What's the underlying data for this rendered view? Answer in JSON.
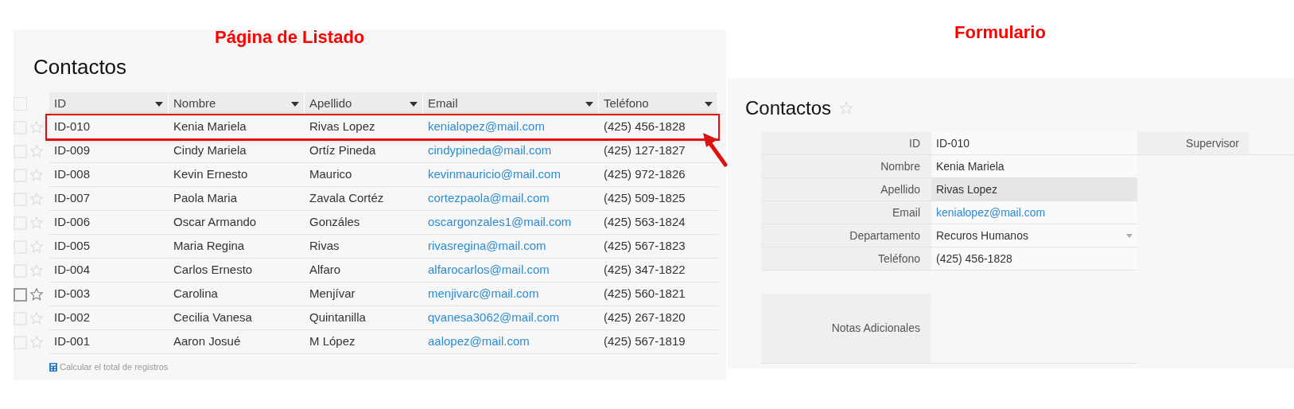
{
  "annotations": {
    "list_label": "Página de Listado",
    "form_label": "Formulario"
  },
  "list": {
    "title": "Contactos",
    "columns": [
      "ID",
      "Nombre",
      "Apellido",
      "Email",
      "Teléfono"
    ],
    "select_all_checked": false,
    "rows": [
      {
        "id": "ID-010",
        "nombre": "Kenia Mariela",
        "apellido": "Rivas Lopez",
        "email": "kenialopez@mail.com",
        "telefono": "(425) 456-1828",
        "highlighted": true,
        "hovered": false,
        "checked": false
      },
      {
        "id": "ID-009",
        "nombre": "Cindy Mariela",
        "apellido": "Ortíz Pineda",
        "email": "cindypineda@mail.com",
        "telefono": "(425) 127-1827",
        "highlighted": false,
        "hovered": false,
        "checked": false
      },
      {
        "id": "ID-008",
        "nombre": "Kevin Ernesto",
        "apellido": "Maurico",
        "email": "kevinmauricio@mail.com",
        "telefono": "(425) 972-1826",
        "highlighted": false,
        "hovered": false,
        "checked": false
      },
      {
        "id": "ID-007",
        "nombre": "Paola Maria",
        "apellido": "Zavala Cortéz",
        "email": "cortezpaola@mail.com",
        "telefono": "(425) 509-1825",
        "highlighted": false,
        "hovered": false,
        "checked": false
      },
      {
        "id": "ID-006",
        "nombre": "Oscar Armando",
        "apellido": "Gonzáles",
        "email": "oscargonzales1@mail.com",
        "telefono": "(425) 563-1824",
        "highlighted": false,
        "hovered": false,
        "checked": false
      },
      {
        "id": "ID-005",
        "nombre": "Maria Regina",
        "apellido": "Rivas",
        "email": "rivasregina@mail.com",
        "telefono": "(425) 567-1823",
        "highlighted": false,
        "hovered": false,
        "checked": false
      },
      {
        "id": "ID-004",
        "nombre": "Carlos Ernesto",
        "apellido": "Alfaro",
        "email": "alfarocarlos@mail.com",
        "telefono": "(425) 347-1822",
        "highlighted": false,
        "hovered": false,
        "checked": false
      },
      {
        "id": "ID-003",
        "nombre": "Carolina",
        "apellido": "Menjívar",
        "email": "menjivarc@mail.com",
        "telefono": "(425) 560-1821",
        "highlighted": false,
        "hovered": true,
        "checked": false
      },
      {
        "id": "ID-002",
        "nombre": "Cecilia Vanesa",
        "apellido": "Quintanilla",
        "email": "qvanesa3062@mail.com",
        "telefono": "(425) 267-1820",
        "highlighted": false,
        "hovered": false,
        "checked": false
      },
      {
        "id": "ID-001",
        "nombre": "Aaron Josué",
        "apellido": "M López",
        "email": "aalopez@mail.com",
        "telefono": "(425) 567-1819",
        "highlighted": false,
        "hovered": false,
        "checked": false
      }
    ],
    "footer_link": "Calcular el total de registros"
  },
  "form": {
    "title": "Contactos",
    "fields": [
      {
        "label": "ID",
        "value": "ID-010",
        "kind": "text",
        "highlighted": false
      },
      {
        "label": "Nombre",
        "value": "Kenia Mariela",
        "kind": "text",
        "highlighted": false
      },
      {
        "label": "Apellido",
        "value": "Rivas Lopez",
        "kind": "text",
        "highlighted": true
      },
      {
        "label": "Email",
        "value": "kenialopez@mail.com",
        "kind": "link",
        "highlighted": false
      },
      {
        "label": "Departamento",
        "value": "Recuros Humanos",
        "kind": "dropdown",
        "highlighted": false
      },
      {
        "label": "Teléfono",
        "value": "(425) 456-1828",
        "kind": "text",
        "highlighted": false
      }
    ],
    "supervisor_label": "Supervisor",
    "notes_label": "Notas Adicionales"
  }
}
